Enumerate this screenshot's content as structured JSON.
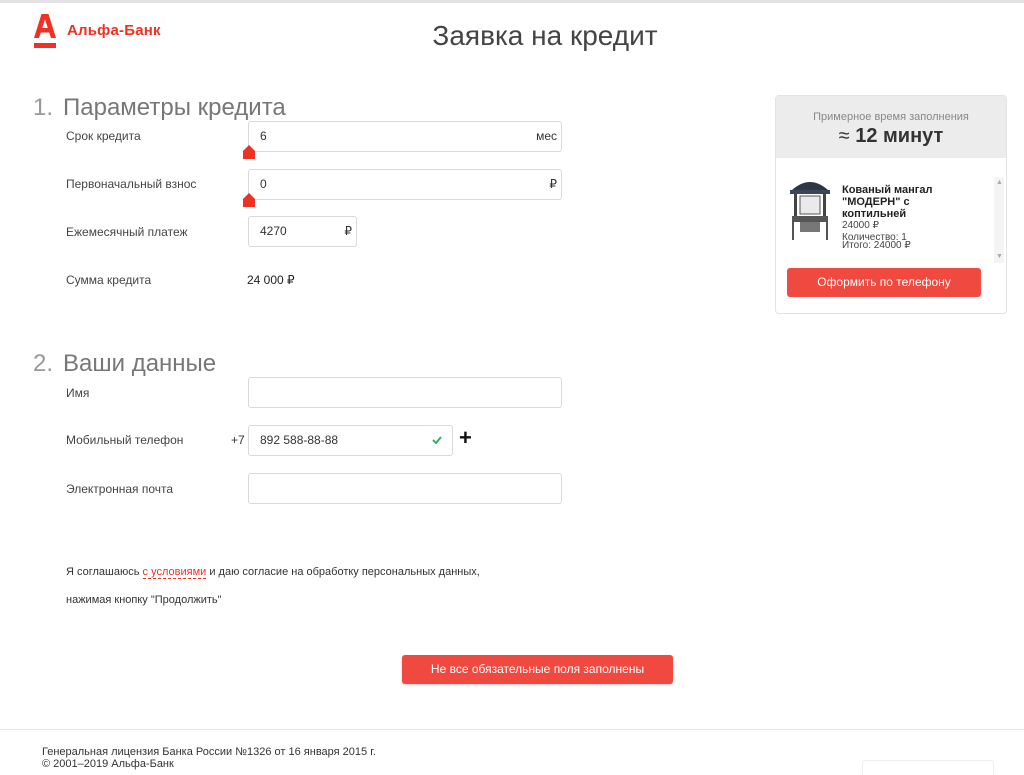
{
  "brand": {
    "name": "Альфа-Банк",
    "color": "#ef3124"
  },
  "page": {
    "title": "Заявка на кредит"
  },
  "section1": {
    "number": "1.",
    "title": "Параметры кредита",
    "term": {
      "label": "Срок кредита",
      "value": "6",
      "unit": "мес"
    },
    "down_payment": {
      "label": "Первоначальный взнос",
      "value": "0",
      "unit": "₽"
    },
    "monthly": {
      "label": "Ежемесячный платеж",
      "value": "4270",
      "unit": "₽"
    },
    "sum": {
      "label": "Сумма кредита",
      "value": "24 000 ₽"
    }
  },
  "section2": {
    "number": "2.",
    "title": "Ваши данные",
    "name": {
      "label": "Имя",
      "value": ""
    },
    "phone": {
      "label": "Мобильный телефон",
      "prefix": "+7",
      "value": "892 588-88-88"
    },
    "email": {
      "label": "Электронная почта",
      "value": ""
    }
  },
  "consent": {
    "before": "Я соглашаюсь ",
    "link": "с условиями",
    "after": " и даю согласие на обработку персональных данных,",
    "line2": "нажимая кнопку \"Продолжить\""
  },
  "submit": {
    "label": "Не все обязательные поля заполнены"
  },
  "side": {
    "caption": "Примерное время заполнения",
    "approx": "≈",
    "time": "12 минут",
    "product": {
      "name": "Кованый мангал \"МОДЕРН\" с коптильней",
      "price": "24000 ₽",
      "qty": "Количество: 1",
      "total": "Итого: 24000 ₽"
    },
    "button": "Оформить по телефону"
  },
  "footer": {
    "license": "Генеральная лицензия Банка России №1326 от 16 января 2015 г.",
    "copyright": "© 2001–2019 Альфа-Банк"
  }
}
